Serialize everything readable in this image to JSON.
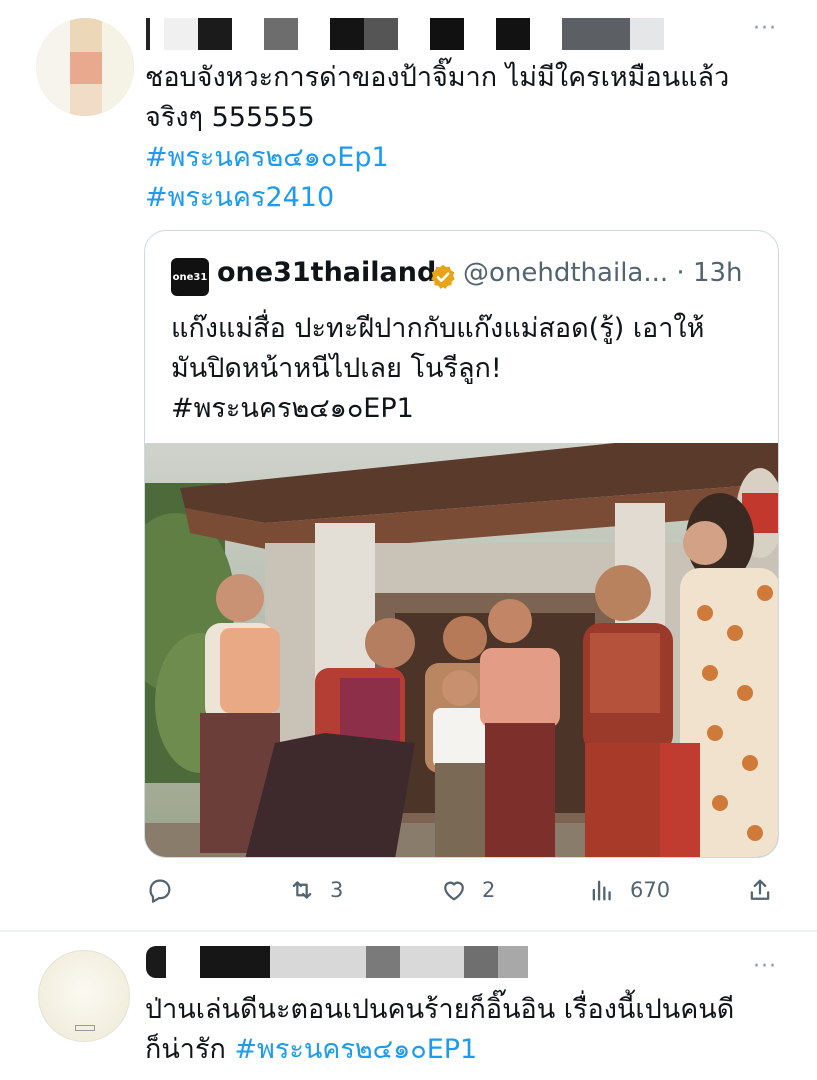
{
  "tweets": [
    {
      "text_line1": "ชอบจังหวะการด่าของป้าจิ๊มาก ไม่มีใครเหมือนแล้ว",
      "text_line2": "จริงๆ 555555",
      "hashtag1": "#พระนคร๒๔๑๐Ep1",
      "hashtag2": "#พระนคร2410",
      "quote": {
        "logo_text": "one31",
        "display_name": "one31thailand",
        "handle_time": "@onehdthaila... · 13h",
        "text_line1": "แก๊งแม่สื่อ ปะทะฝีปากกับแก๊งแม่สอด(รู้) เอาให้",
        "text_line2": "มันปิดหน้าหนีไปเลย โนรีลูก!",
        "text_line3": "#พระนคร๒๔๑๐EP1"
      },
      "actions": {
        "reply_count": "",
        "retweet_count": "3",
        "like_count": "2",
        "views_count": "670"
      }
    },
    {
      "text_line1": "ป่านเล่นดีนะตอนเปนคนร้ายก็อิ๊นอิน เรื่องนี้เปนคนดี",
      "text_line2_plain": "ก็น่ารัก ",
      "text_line2_hashtag": "#พระนคร๒๔๑๐EP1"
    }
  ],
  "more_icon": "···",
  "colors": {
    "hashtag": "#1d9bf0",
    "muted": "#536471",
    "verified": "#e8a317"
  },
  "icons": [
    "reply-icon",
    "retweet-icon",
    "like-icon",
    "views-icon",
    "share-icon",
    "more-icon",
    "verified-badge-icon"
  ]
}
